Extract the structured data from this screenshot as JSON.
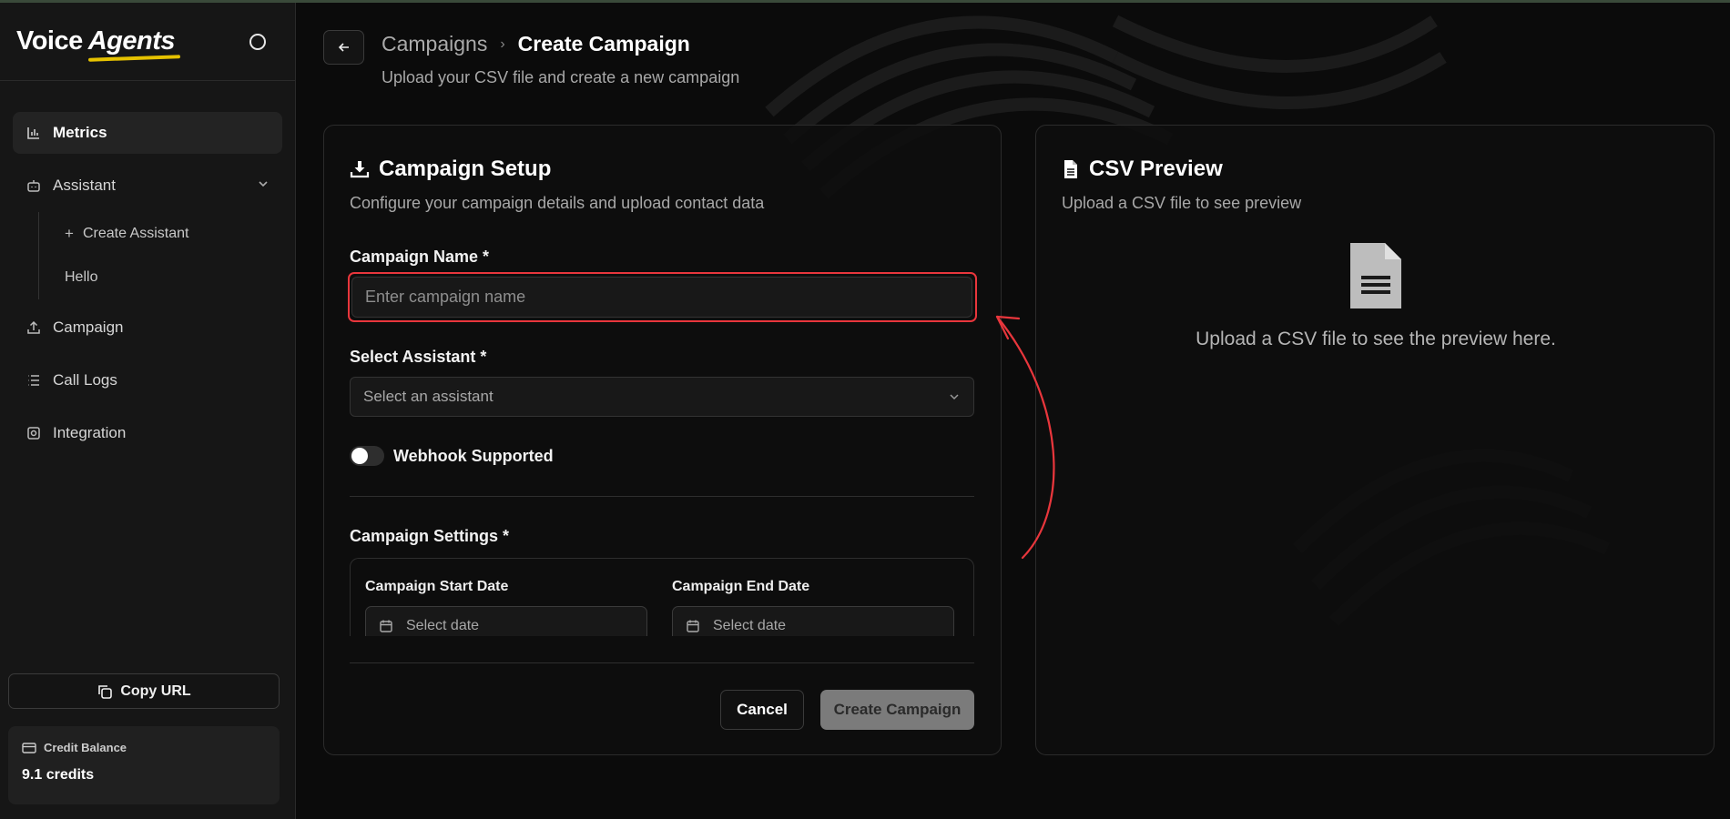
{
  "sidebar": {
    "brand": {
      "word1": "Voice",
      "word2": "Agents"
    },
    "nav": {
      "metrics": "Metrics",
      "assistant": "Assistant",
      "create_assistant": "Create Assistant",
      "hello": "Hello",
      "campaign": "Campaign",
      "call_logs": "Call Logs",
      "integration": "Integration"
    },
    "copy_url": "Copy URL",
    "credit": {
      "label": "Credit Balance",
      "value": "9.1 credits"
    }
  },
  "header": {
    "breadcrumb_parent": "Campaigns",
    "breadcrumb_current": "Create Campaign",
    "subtitle": "Upload your CSV file and create a new campaign"
  },
  "setup": {
    "title": "Campaign Setup",
    "description": "Configure your campaign details and upload contact data",
    "name_label": "Campaign Name *",
    "name_placeholder": "Enter campaign name",
    "name_value": "",
    "assistant_label": "Select Assistant *",
    "assistant_placeholder": "Select an assistant",
    "webhook_label": "Webhook Supported",
    "webhook_on": false,
    "settings_label": "Campaign Settings *",
    "start_date_label": "Campaign Start Date",
    "start_date_placeholder": "Select date",
    "end_date_label": "Campaign End Date",
    "end_date_placeholder": "Select date",
    "cancel": "Cancel",
    "create": "Create Campaign"
  },
  "preview": {
    "title": "CSV Preview",
    "description": "Upload a CSV file to see preview",
    "empty_text": "Upload a CSV file to see the preview here."
  },
  "colors": {
    "accent_highlight": "#e8363c",
    "brand_underline": "#e6c200",
    "background": "#0b0b0b"
  }
}
